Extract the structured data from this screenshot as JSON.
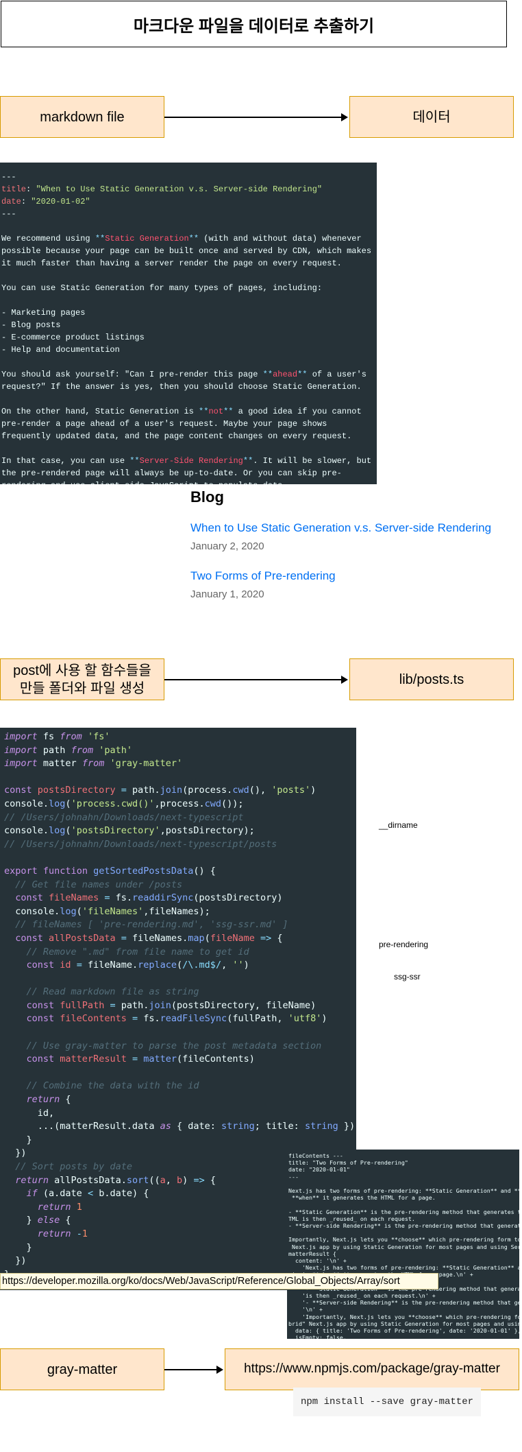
{
  "title": "마크다운 파일을 데이터로 추출하기",
  "boxes": {
    "markdown_file": "markdown file",
    "data": "데이터",
    "post_folder": "post에 사용 할 함수들을\n만들 폴더와 파일 생성",
    "lib_posts": "lib/posts.ts",
    "gray_matter": "gray-matter",
    "npm_url": "https://www.npmjs.com/package/gray-matter"
  },
  "markdown_sample": {
    "frontmatter_delim": "---",
    "title_key": "title",
    "title_value": "\"When to Use Static Generation v.s. Server-side Rendering\"",
    "date_key": "date",
    "date_value": "\"2020-01-02\"",
    "p1_a": "We recommend using ",
    "p1_bold": "Static Generation",
    "p1_b": " (with and without data) whenever\npossible because your page can be built once and served by CDN, which makes\nit much faster than having a server render the page on every request.",
    "p2": "You can use Static Generation for many types of pages, including:",
    "list": "- Marketing pages\n- Blog posts\n- E-commerce product listings\n- Help and documentation",
    "p3_a": "You should ask yourself: \"Can I pre-render this page ",
    "p3_bold": "ahead",
    "p3_b": " of a user's\nrequest?\" If the answer is yes, then you should choose Static Generation.",
    "p4_a": "On the other hand, Static Generation is ",
    "p4_bold": "not",
    "p4_b": " a good idea if you cannot\npre-render a page ahead of a user's request. Maybe your page shows\nfrequently updated data, and the page content changes on every request.",
    "p5_a": "In that case, you can use ",
    "p5_bold": "Server-Side Rendering",
    "p5_b": ". It will be slower, but\nthe pre-rendered page will always be up-to-date. Or you can skip pre-\nrendering and use client-side JavaScript to populate data."
  },
  "blog": {
    "heading": "Blog",
    "posts": [
      {
        "title": "When to Use Static Generation v.s. Server-side Rendering",
        "date": "January 2, 2020"
      },
      {
        "title": "Two Forms of Pre-rendering",
        "date": "January 1, 2020"
      }
    ]
  },
  "notes": {
    "dirname": "__dirname",
    "pre_rendering": "pre-rendering",
    "ssg_ssr": "ssg-ssr"
  },
  "code": {
    "l1": "import fs from 'fs'",
    "l2": "import path from 'path'",
    "l3": "import matter from 'gray-matter'",
    "c_cwd": "// /Users/johnahn/Downloads/next-typescript",
    "c_posts": "// /Users/johnahn/Downloads/next-typescript/posts",
    "c_names": "// Get file names under /posts",
    "c_names_list": "// fileNames [ 'pre-rendering.md', 'ssg-ssr.md' ]",
    "c_remove": "// Remove \".md\" from file name to get id",
    "c_read": "// Read markdown file as string",
    "c_gray": "// Use gray-matter to parse the post metadata section",
    "c_combine": "// Combine the data with the id",
    "c_sort": "// Sort posts by date"
  },
  "filecontents": {
    "text": "fileContents ---\ntitle: \"Two Forms of Pre-rendering\"\ndate: \"2020-01-01\"\n---\n\nNext.js has two forms of pre-rendering: **Static Generation** and **Server-side Rendering**.\n **when** it generates the HTML for a page.\n\n- **Static Generation** is the pre-rendering method that generates the H\nTML is then _reused_ on each request.\n- **Server-side Rendering** is the pre-rendering method that generates the\n\nImportantly, Next.js lets you **choose** which pre-rendering form to use\n Next.js app by using Static Generation for most pages and using Server-side\nmatterResult {\n  content: '\\n' +\n    'Next.js has two forms of pre-rendering: **Static Generation** and\n is in **when** it generates the HTML for a page.\\n' +\n    '\\n' +\n    '- **Static Generation** is the pre-rendering method that generates\n    'is then _reused_ on each request.\\n' +\n    '- **Server-side Rendering** is the pre-rendering method that gener\n    '\\n' +\n    'Importantly, Next.js lets you **choose** which pre-rendering form\nbrid\" Next.js app by using Static Generation for most pages and usin\n  data: { title: 'Two Forms of Pre-rendering', date: '2020-01-01' },\n  isEmpty: false,"
  },
  "mdn_url": "https://developer.mozilla.org/ko/docs/Web/JavaScript/Reference/Global_Objects/Array/sort",
  "npm_install": "npm install --save gray-matter"
}
